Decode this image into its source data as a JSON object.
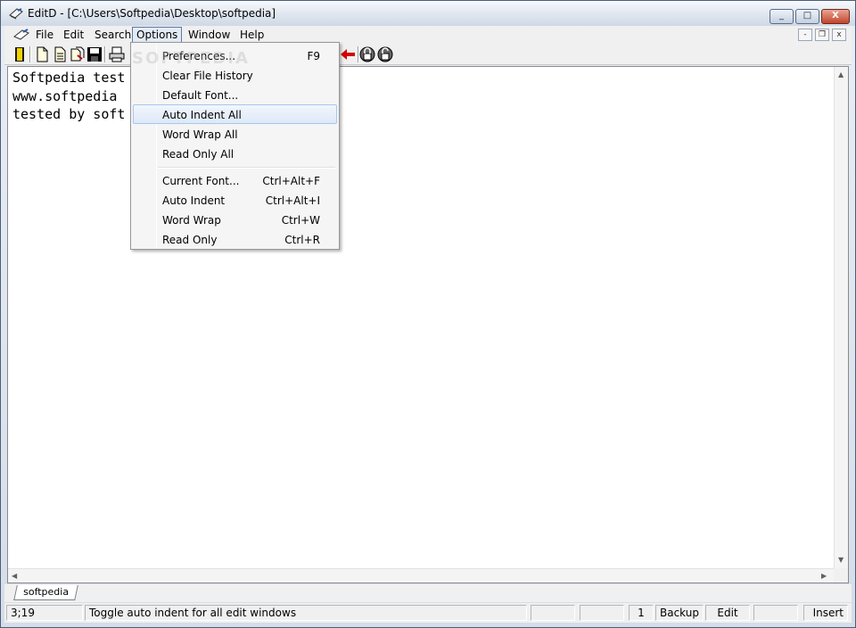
{
  "window": {
    "title": "EditD - [C:\\Users\\Softpedia\\Desktop\\softpedia]",
    "minimize_glyph": "_",
    "maximize_glyph": "□",
    "close_glyph": "X"
  },
  "menubar": {
    "items": [
      "File",
      "Edit",
      "Search",
      "Options",
      "Window",
      "Help"
    ],
    "active": "Options",
    "mdi_buttons": [
      "-",
      "❐",
      "x"
    ]
  },
  "toolbar": {
    "icons": [
      "exit-icon",
      "new-file-icon",
      "open-file-icon",
      "recent-files-icon",
      "save-icon",
      "print-icon",
      "back-arrow-icon",
      "lock-icon",
      "unlock-icon"
    ]
  },
  "editor": {
    "lines": [
      "Softpedia test",
      "www.softpedia",
      "tested by soft"
    ]
  },
  "options_menu": {
    "items": [
      {
        "label": "Preferences...",
        "shortcut": "F9"
      },
      {
        "label": "Clear File History",
        "shortcut": ""
      },
      {
        "label": "Default Font...",
        "shortcut": ""
      },
      {
        "label": "Auto Indent All",
        "shortcut": ""
      },
      {
        "label": "Word Wrap All",
        "shortcut": ""
      },
      {
        "label": "Read Only All",
        "shortcut": ""
      },
      {
        "label": "Current Font...",
        "shortcut": "Ctrl+Alt+F"
      },
      {
        "label": "Auto Indent",
        "shortcut": "Ctrl+Alt+I"
      },
      {
        "label": "Word Wrap",
        "shortcut": "Ctrl+W"
      },
      {
        "label": "Read Only",
        "shortcut": "Ctrl+R"
      }
    ],
    "highlighted": "Auto Indent All"
  },
  "tabs": [
    "softpedia"
  ],
  "status": {
    "position": "3;19",
    "message": "Toggle auto indent for all edit windows",
    "field1": "",
    "field2": "",
    "count": "1",
    "backup": "Backup",
    "mode": "Edit",
    "field3": "",
    "insert": "Insert"
  },
  "watermark": "SOFTPEDIA"
}
